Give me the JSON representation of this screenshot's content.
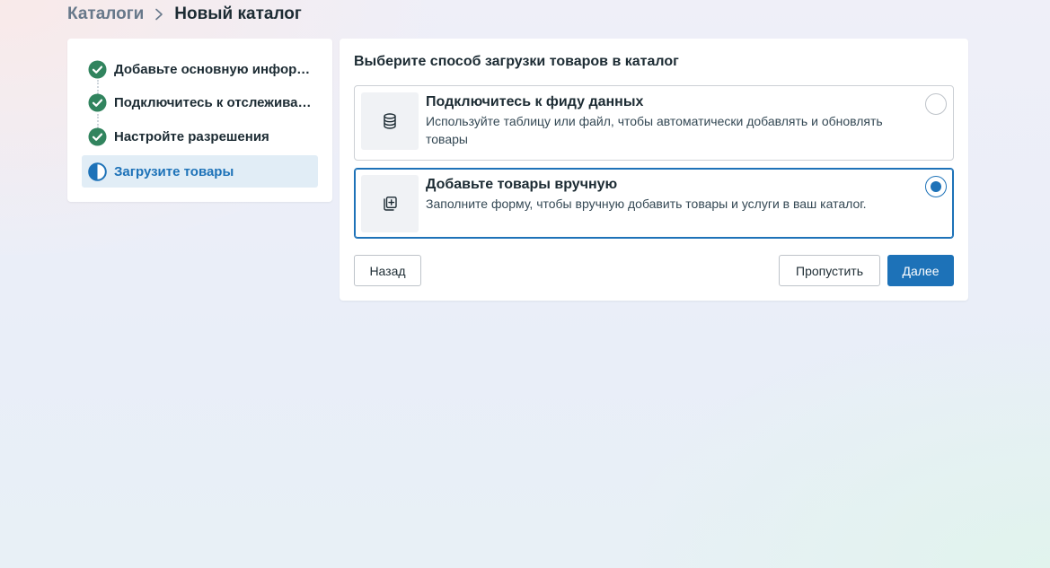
{
  "breadcrumb": {
    "parent": "Каталоги",
    "current": "Новый каталог"
  },
  "steps": [
    {
      "label": "Добавьте основную информацию",
      "status": "done",
      "icon": "check-circle-icon"
    },
    {
      "label": "Подключитесь к отслеживанию",
      "status": "done",
      "icon": "check-circle-icon"
    },
    {
      "label": "Настройте разрешения",
      "status": "done",
      "icon": "check-circle-icon"
    },
    {
      "label": "Загрузите товары",
      "status": "in-progress",
      "icon": "half-circle-icon"
    }
  ],
  "main": {
    "title": "Выберите способ загрузки товаров в каталог",
    "options": [
      {
        "title": "Подключитесь к фиду данных",
        "description": "Используйте таблицу или файл, чтобы автоматически добавлять и обновлять товары",
        "icon": "database-icon",
        "selected": false
      },
      {
        "title": "Добавьте товары вручную",
        "description": "Заполните форму, чтобы вручную добавить товары и услуги в ваш каталог.",
        "icon": "add-item-icon",
        "selected": true
      }
    ]
  },
  "buttons": {
    "back": "Назад",
    "skip": "Пропустить",
    "next": "Далее"
  },
  "colors": {
    "accent": "#1d72b8",
    "success": "#31845e",
    "active_step_bg": "#e1edf6"
  }
}
